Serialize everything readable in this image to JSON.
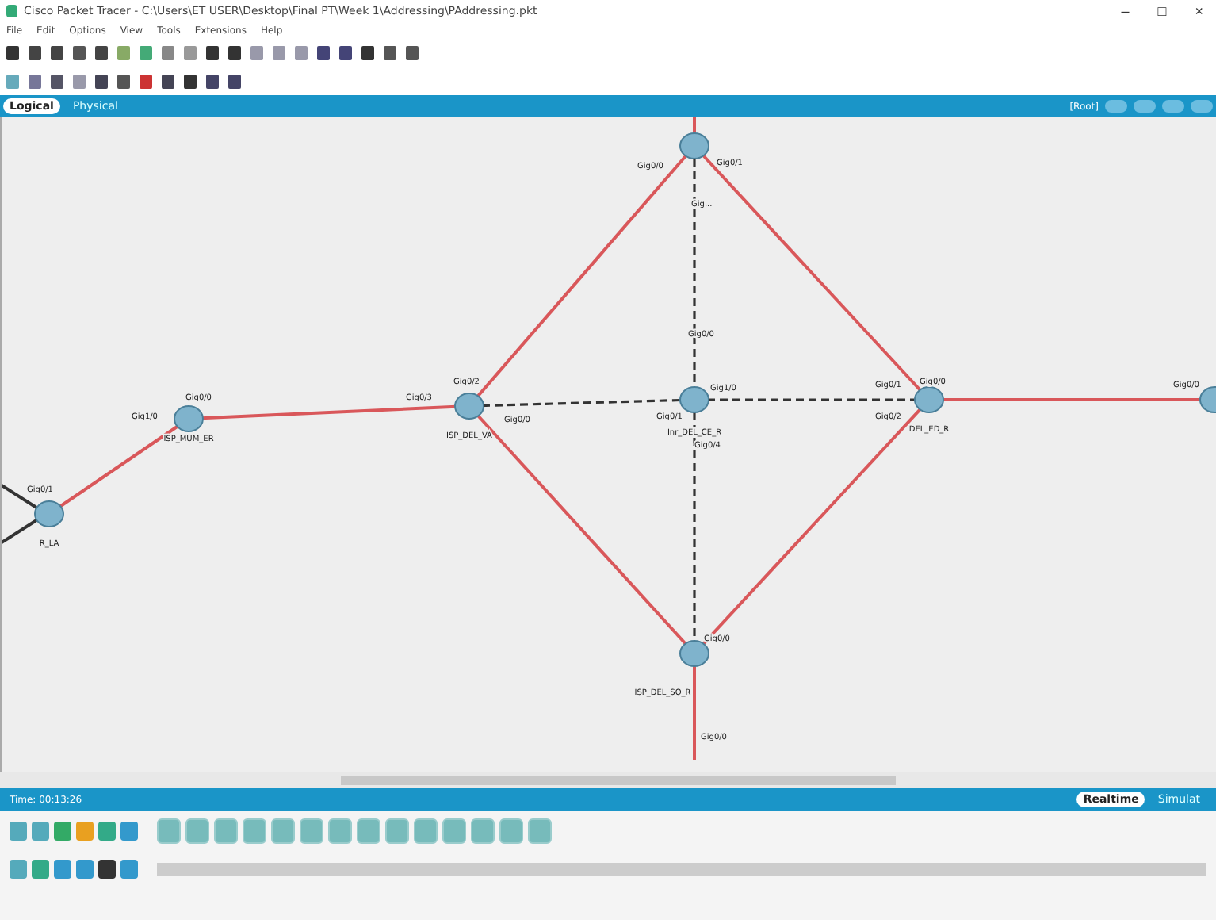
{
  "window": {
    "title": "Cisco Packet Tracer - C:\\Users\\ET USER\\Desktop\\Final PT\\Week 1\\Addressing\\PAddressing.pkt",
    "controls": [
      "–",
      "□",
      "×"
    ]
  },
  "menu": [
    "File",
    "Edit",
    "Options",
    "View",
    "Tools",
    "Extensions",
    "Help"
  ],
  "tabs": [
    {
      "label": "Logical",
      "selected": true
    },
    {
      "label": "Physical",
      "selected": false
    }
  ],
  "root_label": "[Root]",
  "devices": [
    {
      "ports": [
        "Gig0/0",
        "Gig0/1",
        "Gig..."
      ]
    },
    {
      "name": "ISP_DEL_VA",
      "ports": [
        "Gig0/2",
        "Gig0/3",
        "Gig0/0"
      ]
    },
    {
      "name": "Inr_DEL_CE_R",
      "ports": [
        "Gig1/0",
        "Gig0/1",
        "Gig0/0",
        "Gig0/4"
      ]
    },
    {
      "name": "DEL_ED_R",
      "ports": [
        "Gig0/1",
        "Gig0/0",
        "Gig0/2"
      ]
    },
    {
      "name": "ISP_DEL_SO_R",
      "ports": [
        "Gig0/0",
        "Gig0/0"
      ]
    },
    {
      "name": "ISP_MUM_ER",
      "ports": [
        "Gig0/0",
        "Gig1/0"
      ]
    },
    {
      "name": "R_LA",
      "ports": [
        "Gig0/1"
      ]
    },
    {
      "ports": [
        "Gig0/0"
      ]
    }
  ],
  "links": [
    {
      "kind": "copper"
    },
    {
      "kind": "copper"
    },
    {
      "kind": "copper"
    },
    {
      "kind": "copper"
    },
    {
      "kind": "copper"
    },
    {
      "kind": "copper"
    },
    {
      "kind": "copper"
    },
    {
      "kind": "crossover"
    },
    {
      "kind": "crossover"
    },
    {
      "kind": "crossover"
    },
    {
      "kind": "crossover"
    }
  ],
  "status": {
    "time": "Time: 00:13:26",
    "modes": [
      {
        "label": "Realtime",
        "selected": true
      },
      {
        "label": "Simulat",
        "selected": false
      }
    ]
  }
}
